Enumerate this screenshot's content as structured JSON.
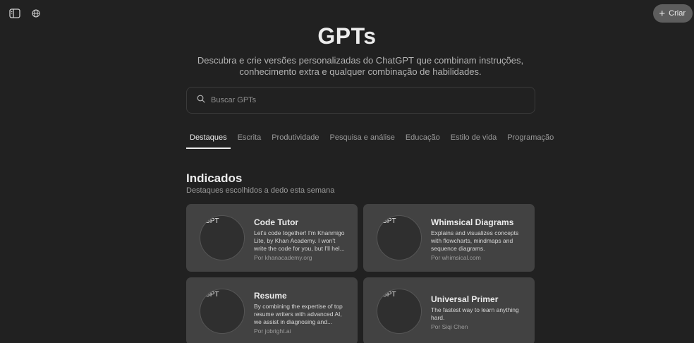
{
  "toolbar": {
    "sidebar_icon": "sidebar-toggle-icon",
    "language_icon": "globe-icon",
    "create_label": "Criar"
  },
  "header": {
    "title": "GPTs",
    "subtitle_line1": "Descubra e crie versões personalizadas do ChatGPT que combinam instruções,",
    "subtitle_line2": "conhecimento extra e qualquer combinação de habilidades."
  },
  "search": {
    "placeholder": "Buscar GPTs",
    "value": ""
  },
  "tabs": [
    {
      "label": "Destaques",
      "active": true
    },
    {
      "label": "Escrita"
    },
    {
      "label": "Produtividade"
    },
    {
      "label": "Pesquisa e análise"
    },
    {
      "label": "Educação"
    },
    {
      "label": "Estilo de vida"
    },
    {
      "label": "Programação"
    }
  ],
  "section": {
    "title": "Indicados",
    "subtitle": "Destaques escolhidos a dedo esta semana"
  },
  "cards": [
    {
      "avatar_label": "GPT",
      "name": "Code Tutor",
      "desc_lines": [
        "Let's code together! I'm Khanmigo",
        "Lite, by Khan Academy. I won't",
        "write the code for you, but I'll hel..."
      ],
      "author": "Por khanacademy.org"
    },
    {
      "avatar_label": "GPT",
      "name": "Whimsical Diagrams",
      "desc_lines": [
        "Explains and visualizes concepts",
        "with flowcharts, mindmaps and",
        "sequence diagrams."
      ],
      "author": "Por whimsical.com"
    },
    {
      "avatar_label": "GPT",
      "name": "Resume",
      "desc_lines": [
        "By combining the expertise of top",
        "resume writers with advanced AI,",
        "we assist in diagnosing and..."
      ],
      "author": "Por jobright.ai"
    },
    {
      "avatar_label": "GPT",
      "name": "Universal Primer",
      "desc_lines": [
        "The fastest way to learn anything",
        "hard."
      ],
      "author": "Por Siqi Chen"
    }
  ]
}
